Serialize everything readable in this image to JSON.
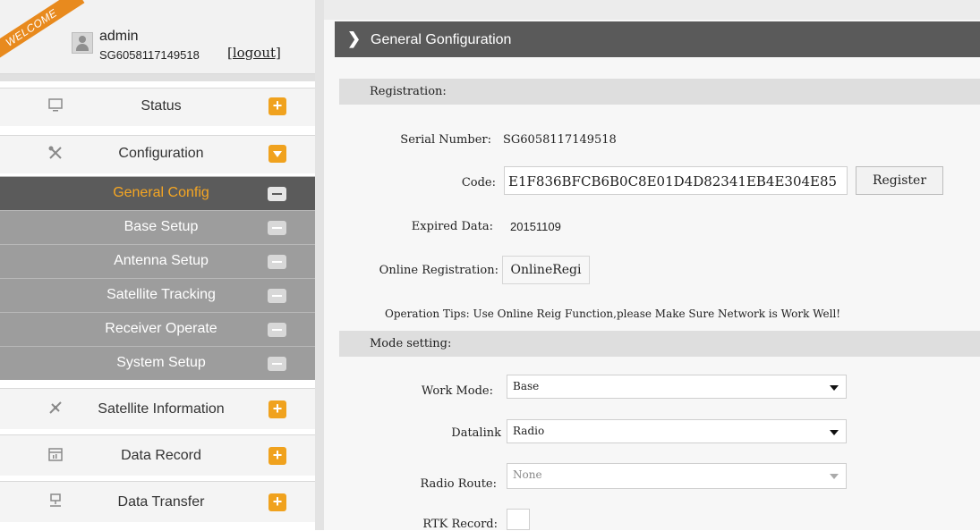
{
  "user": {
    "ribbon": "WELCOME",
    "name": "admin",
    "serial": "SG6058117149518",
    "logout": "[logout]"
  },
  "nav": {
    "status": {
      "label": "Status",
      "icon": "monitor-icon"
    },
    "configuration": {
      "label": "Configuration",
      "icon": "tools-icon"
    },
    "sub": [
      {
        "label": "General Config",
        "active": true
      },
      {
        "label": "Base Setup"
      },
      {
        "label": "Antenna Setup"
      },
      {
        "label": "Satellite Tracking"
      },
      {
        "label": "Receiver Operate"
      },
      {
        "label": "System Setup"
      }
    ],
    "satellite_information": {
      "label": "Satellite Information",
      "icon": "satellite-icon"
    },
    "data_record": {
      "label": "Data Record",
      "icon": "calendar-icon"
    },
    "data_transfer": {
      "label": "Data Transfer",
      "icon": "network-icon"
    }
  },
  "header": {
    "title": "General Gonfiguration"
  },
  "registration": {
    "section_label": "Registration:",
    "serial_label": "Serial Number:",
    "serial_value": "SG6058117149518",
    "code_label": "Code:",
    "code_value": "E1F836BFCB6B0C8E01D4D82341EB4E304E85",
    "register_button": "Register",
    "expired_label": "Expired Data:",
    "expired_value": "20151109",
    "online_label": "Online Registration:",
    "online_button": "OnlineRegi",
    "tips": "Operation Tips: Use Online Reig Function,please Make Sure Network is Work Well!"
  },
  "mode": {
    "section_label": "Mode setting:",
    "work_mode_label": "Work Mode:",
    "work_mode_value": "Base",
    "datalink_label": "Datalink",
    "datalink_value": "Radio",
    "radio_route_label": "Radio Route:",
    "radio_route_value": "None",
    "rtk_record_label": "RTK Record:"
  },
  "colors": {
    "accent": "#f0a21e",
    "active_text": "#f5a623",
    "header_bg": "#5a5a5a",
    "submenu_bg": "#9d9d9d",
    "submenu_active_bg": "#5b5b5b"
  }
}
